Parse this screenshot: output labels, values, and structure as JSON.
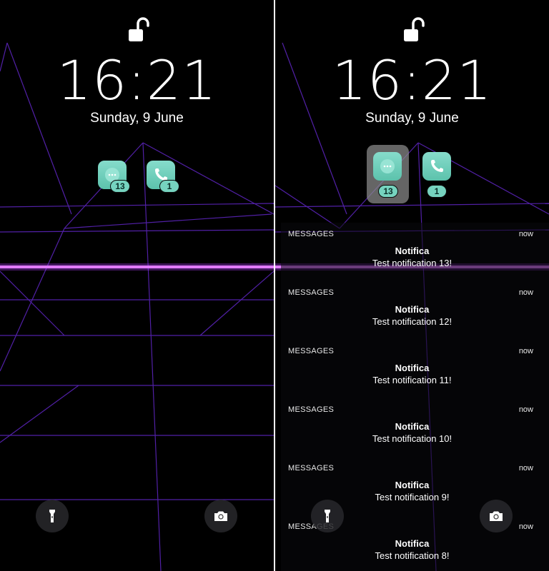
{
  "left": {
    "time": "16:21",
    "date": "Sunday, 9 June",
    "apps": [
      {
        "icon": "messages-icon",
        "badge": "13"
      },
      {
        "icon": "phone-icon",
        "badge": "1"
      }
    ],
    "bottom_buttons": [
      {
        "icon": "flashlight-icon"
      },
      {
        "icon": "camera-icon"
      }
    ]
  },
  "right": {
    "time": "16:21",
    "date": "Sunday, 9 June",
    "apps": [
      {
        "icon": "messages-icon",
        "badge": "13",
        "selected": true
      },
      {
        "icon": "phone-icon",
        "badge": "1"
      }
    ],
    "notifications": [
      {
        "app": "MESSAGES",
        "time": "now",
        "title": "Notifica",
        "body": "Test notification 13!"
      },
      {
        "app": "MESSAGES",
        "time": "now",
        "title": "Notifica",
        "body": "Test notification 12!"
      },
      {
        "app": "MESSAGES",
        "time": "now",
        "title": "Notifica",
        "body": "Test notification 11!"
      },
      {
        "app": "MESSAGES",
        "time": "now",
        "title": "Notifica",
        "body": "Test notification 10!"
      },
      {
        "app": "MESSAGES",
        "time": "now",
        "title": "Notifica",
        "body": "Test notification 9!"
      },
      {
        "app": "MESSAGES",
        "time": "now",
        "title": "Notifica",
        "body": "Test notification 8!"
      }
    ],
    "bottom_buttons": [
      {
        "icon": "flashlight-icon"
      },
      {
        "icon": "camera-icon"
      }
    ]
  },
  "colors": {
    "grid_purple": "#6a2bd1",
    "horizon_glow": "#b23cff",
    "app_icon_teal": "#6ccfb9"
  }
}
